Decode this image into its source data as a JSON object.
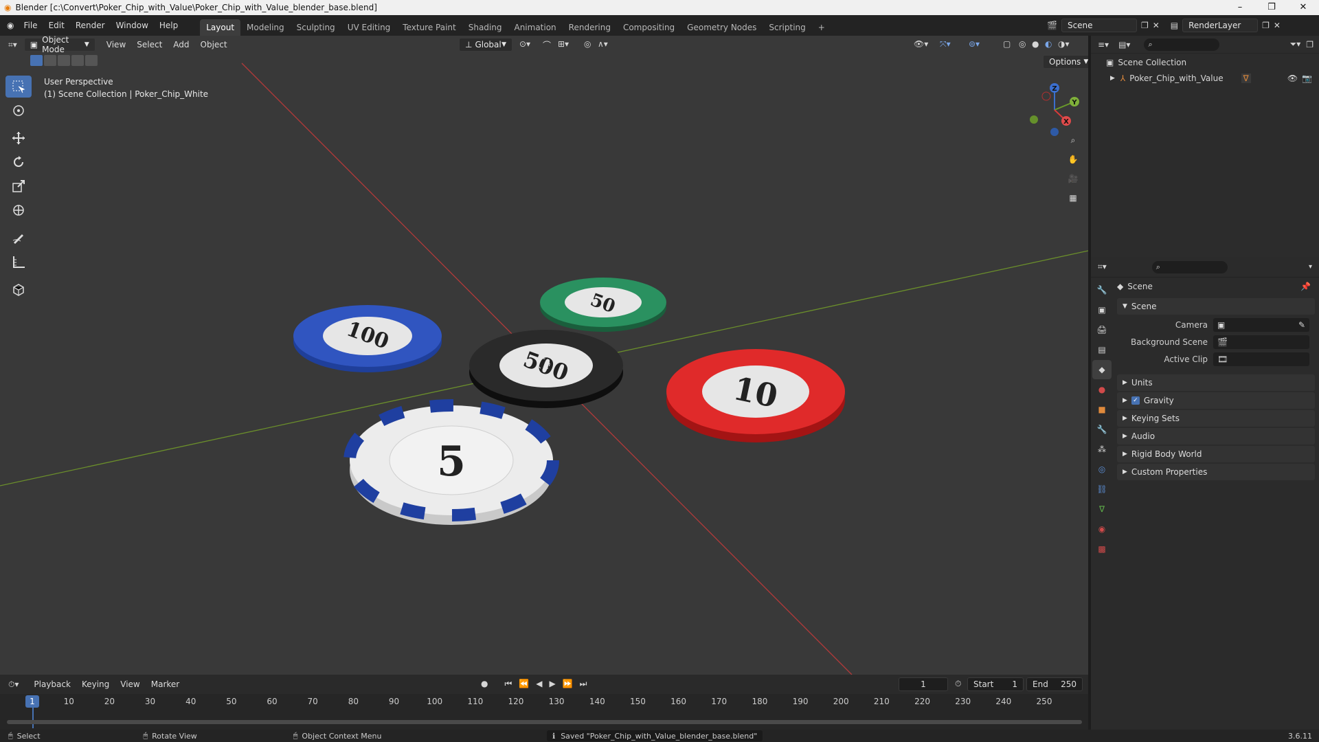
{
  "window": {
    "title": "Blender [c:\\Convert\\Poker_Chip_with_Value\\Poker_Chip_with_Value_blender_base.blend]"
  },
  "menubar": {
    "menus": [
      "File",
      "Edit",
      "Render",
      "Window",
      "Help"
    ],
    "workspaces": [
      "Layout",
      "Modeling",
      "Sculpting",
      "UV Editing",
      "Texture Paint",
      "Shading",
      "Animation",
      "Rendering",
      "Compositing",
      "Geometry Nodes",
      "Scripting"
    ],
    "active_workspace": "Layout",
    "scene_name": "Scene",
    "view_layer": "RenderLayer"
  },
  "viewport": {
    "mode": "Object Mode",
    "menus": [
      "View",
      "Select",
      "Add",
      "Object"
    ],
    "transform_orientation": "Global",
    "options_label": "Options",
    "perspective_label": "User Perspective",
    "collection_label": "(1) Scene Collection | Poker_Chip_White",
    "gizmo_axes": [
      "X",
      "Y",
      "Z"
    ],
    "chips": [
      {
        "value": "100",
        "color": "#1f3f9a"
      },
      {
        "value": "50",
        "color": "#1f7a4e"
      },
      {
        "value": "500",
        "color": "#1a1a1a"
      },
      {
        "value": "10",
        "color": "#d21f1f"
      },
      {
        "value": "5",
        "color": "#1f3fa0"
      }
    ]
  },
  "outliner": {
    "root": "Scene Collection",
    "items": [
      {
        "label": "Poker_Chip_with_Value"
      }
    ]
  },
  "properties": {
    "header_title": "Scene",
    "panel_title": "Scene",
    "fields": [
      {
        "label": "Camera"
      },
      {
        "label": "Background Scene"
      },
      {
        "label": "Active Clip"
      }
    ],
    "sections": [
      "Units",
      "Gravity",
      "Keying Sets",
      "Audio",
      "Rigid Body World",
      "Custom Properties"
    ],
    "gravity_checked": true
  },
  "timeline": {
    "menus": [
      "Playback",
      "Keying",
      "View",
      "Marker"
    ],
    "current_frame": "1",
    "start_label": "Start",
    "start_value": "1",
    "end_label": "End",
    "end_value": "250",
    "ruler": [
      "1",
      "10",
      "20",
      "30",
      "40",
      "50",
      "60",
      "70",
      "80",
      "90",
      "100",
      "110",
      "120",
      "130",
      "140",
      "150",
      "160",
      "170",
      "180",
      "190",
      "200",
      "210",
      "220",
      "230",
      "240",
      "250"
    ]
  },
  "statusbar": {
    "select": "Select",
    "rotate": "Rotate View",
    "context": "Object Context Menu",
    "message": "Saved \"Poker_Chip_with_Value_blender_base.blend\"",
    "version": "3.6.11"
  }
}
